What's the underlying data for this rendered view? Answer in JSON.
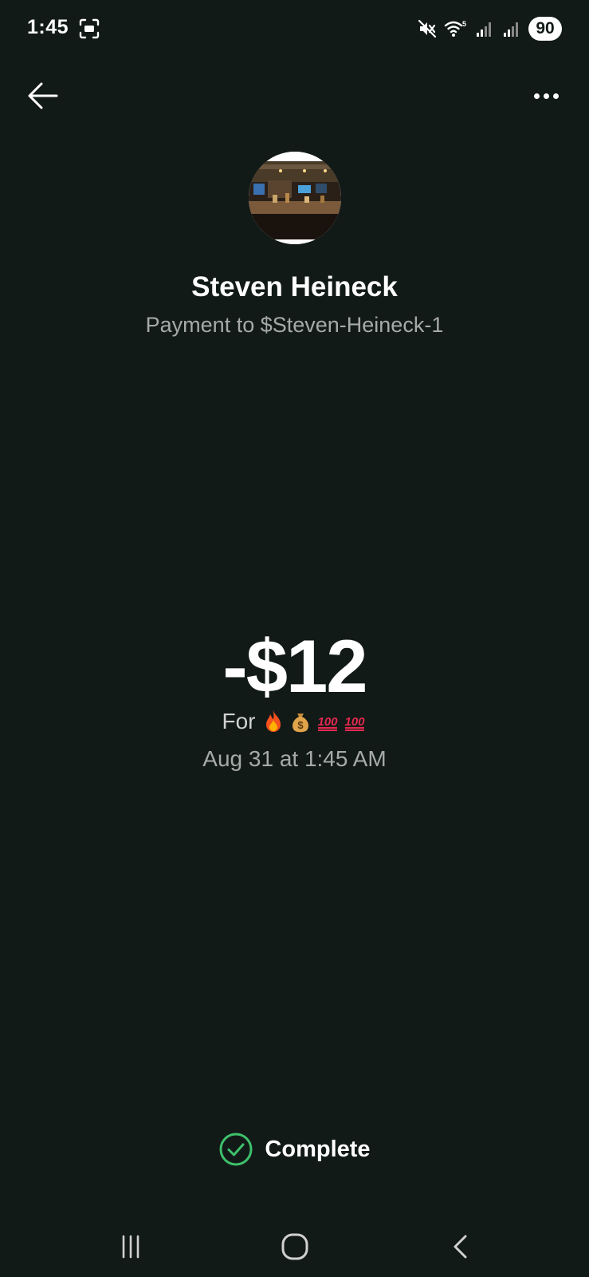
{
  "status_bar": {
    "time": "1:45",
    "battery": "90",
    "icons": [
      "screen-record-icon",
      "mute-icon",
      "wifi-icon",
      "signal-icon",
      "signal-icon"
    ]
  },
  "nav": {
    "back_icon": "arrow-left-icon",
    "more_icon": "more-horizontal-icon"
  },
  "recipient": {
    "name": "Steven Heineck",
    "subtitle": "Payment to $Steven-Heineck-1"
  },
  "transaction": {
    "amount": "-$12",
    "for_label": "For",
    "note_emojis": [
      "fire-emoji",
      "money-bag-emoji",
      "hundred-points-emoji",
      "hundred-points-emoji"
    ],
    "date": "Aug 31 at 1:45 AM",
    "status": "Complete",
    "status_color": "#3ec06b"
  },
  "system_nav": {
    "recent_icon": "recent-apps-icon",
    "home_icon": "home-icon",
    "back_icon": "back-icon"
  },
  "colors": {
    "background": "#121a18",
    "primary_text": "#ffffff",
    "secondary_text": "#a6aaa8",
    "success": "#3ec06b"
  }
}
